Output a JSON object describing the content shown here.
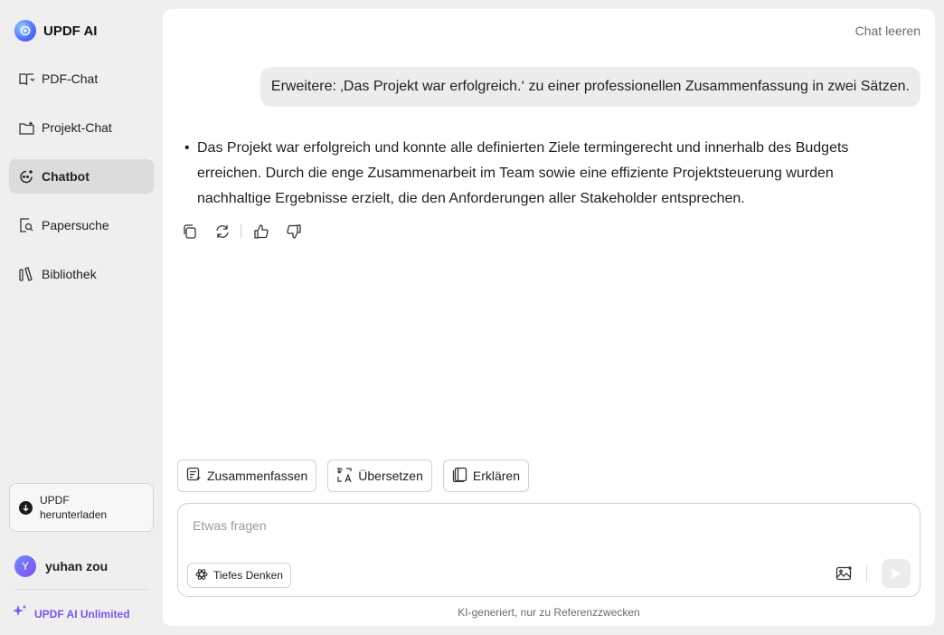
{
  "brand": {
    "name": "UPDF AI"
  },
  "sidebar": {
    "items": [
      {
        "label": "PDF-Chat",
        "icon": "book-open-icon",
        "active": false
      },
      {
        "label": "Projekt-Chat",
        "icon": "folder-plus-icon",
        "active": false
      },
      {
        "label": "Chatbot",
        "icon": "chatbot-icon",
        "active": true
      },
      {
        "label": "Papersuche",
        "icon": "paper-search-icon",
        "active": false
      },
      {
        "label": "Bibliothek",
        "icon": "library-icon",
        "active": false
      }
    ],
    "download_label": "UPDF herunterladen",
    "user": {
      "initial": "Y",
      "name": "yuhan zou"
    },
    "unlimited_label": "UPDF AI Unlimited"
  },
  "main": {
    "clear_chat": "Chat leeren",
    "user_message": "Erweitere: ‚Das Projekt war erfolgreich.‘ zu einer professionellen Zusammenfassung in zwei Sätzen.",
    "answer_bullet": "•",
    "answer_text": "Das Projekt war erfolgreich und konnte alle definierten Ziele termingerecht und innerhalb des Budgets erreichen. Durch die enge Zusammenarbeit im Team sowie eine effiziente Projektsteuerung wurden nachhaltige Ergebnisse erzielt, die den Anforderungen aller Stakeholder entsprechen.",
    "chips": [
      {
        "label": "Zusammenfassen",
        "icon": "summarize-icon"
      },
      {
        "label": "Übersetzen",
        "icon": "translate-icon"
      },
      {
        "label": "Erklären",
        "icon": "explain-icon"
      }
    ],
    "composer": {
      "placeholder": "Etwas fragen",
      "deep_think_label": "Tiefes Denken"
    },
    "disclaimer": "KI-generiert, nur zu Referenzzwecken"
  },
  "colors": {
    "accent": "#7a55e8",
    "active_nav": "#dcdcdc",
    "background": "#efefef"
  }
}
